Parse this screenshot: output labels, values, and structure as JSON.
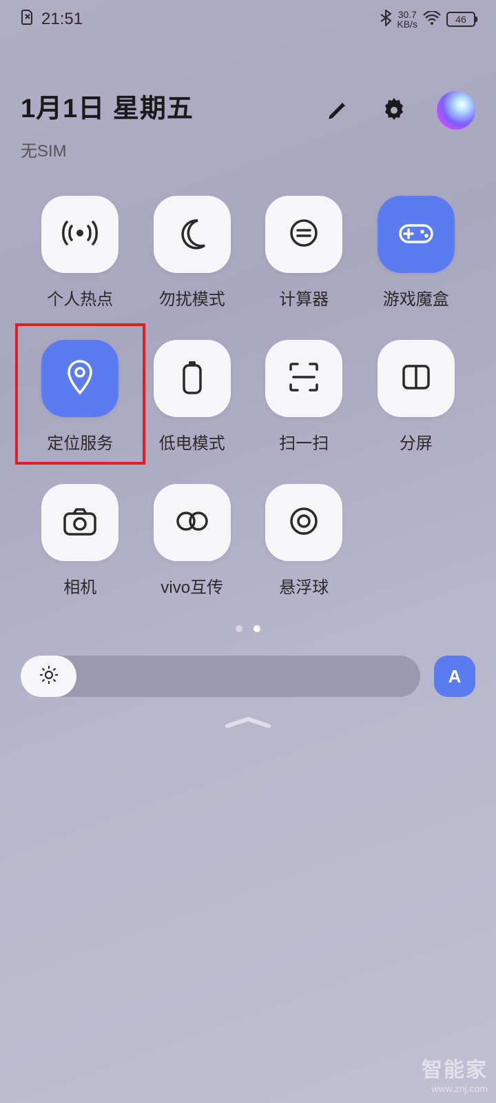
{
  "status": {
    "time": "21:51",
    "net_speed_value": "30.7",
    "net_speed_unit": "KB/s",
    "battery_text": "46"
  },
  "header": {
    "date": "1月1日 星期五",
    "sim": "无SIM"
  },
  "tiles": [
    {
      "id": "hotspot",
      "label": "个人热点",
      "active": false,
      "icon": "hotspot"
    },
    {
      "id": "dnd",
      "label": "勿扰模式",
      "active": false,
      "icon": "moon"
    },
    {
      "id": "calc",
      "label": "计算器",
      "active": false,
      "icon": "calculator"
    },
    {
      "id": "gamebox",
      "label": "游戏魔盒",
      "active": true,
      "icon": "gamepad"
    },
    {
      "id": "location",
      "label": "定位服务",
      "active": true,
      "icon": "pin"
    },
    {
      "id": "lowpower",
      "label": "低电模式",
      "active": false,
      "icon": "battery"
    },
    {
      "id": "scan",
      "label": "扫一扫",
      "active": false,
      "icon": "scan"
    },
    {
      "id": "split",
      "label": "分屏",
      "active": false,
      "icon": "split"
    },
    {
      "id": "camera",
      "label": "相机",
      "active": false,
      "icon": "camera"
    },
    {
      "id": "vivoshare",
      "label": "vivo互传",
      "active": false,
      "icon": "link"
    },
    {
      "id": "floatball",
      "label": "悬浮球",
      "active": false,
      "icon": "circle-dot"
    }
  ],
  "highlight_tile_index": 4,
  "pager": {
    "count": 2,
    "active": 1
  },
  "brightness": {
    "percent": 14,
    "auto_label": "A"
  },
  "watermark": {
    "main": "智能家",
    "sub": "www.znj.com"
  },
  "colors": {
    "accent": "#5b7cf0",
    "tile_bg": "#f6f6f8",
    "highlight": "#e02020"
  }
}
